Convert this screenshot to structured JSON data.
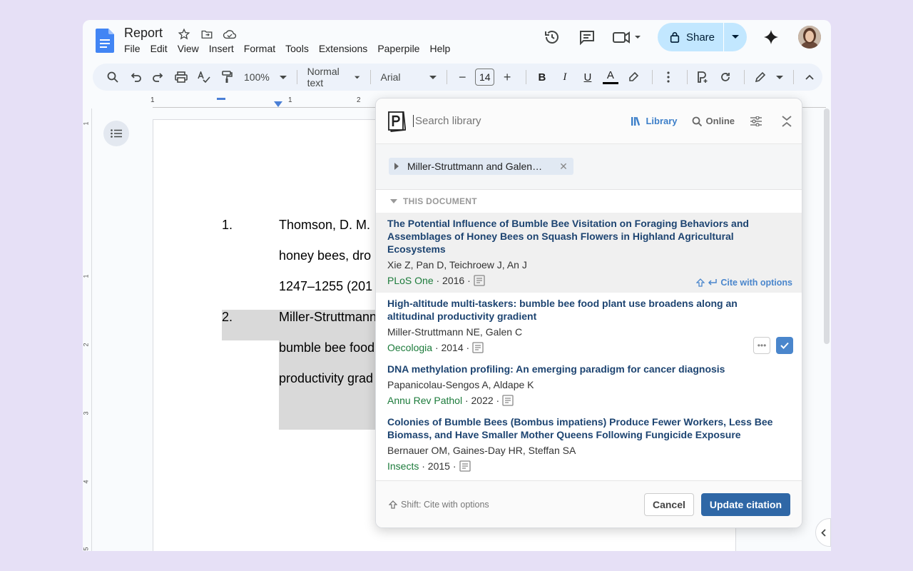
{
  "doc": {
    "title": "Report",
    "menu": [
      "File",
      "Edit",
      "View",
      "Insert",
      "Format",
      "Tools",
      "Extensions",
      "Paperpile",
      "Help"
    ]
  },
  "header": {
    "share_label": "Share"
  },
  "toolbar": {
    "zoom": "100%",
    "style": "Normal text",
    "font": "Arial",
    "font_size": "14",
    "minus": "−",
    "plus": "+",
    "bold": "B",
    "italic": "I",
    "underline": "U",
    "text_color": "A"
  },
  "ruler": {
    "marks": [
      "1",
      "1",
      "2"
    ]
  },
  "vruler": {
    "marks": [
      "1",
      "1",
      "2",
      "3",
      "4",
      "5"
    ]
  },
  "document": {
    "refs": [
      {
        "num": "1.",
        "lines": [
          "Thomson, D. M.",
          "honey bees, dro",
          "1247–1255 (201"
        ]
      },
      {
        "num": "2.",
        "lines": [
          "Miller-Struttmann",
          "bumble bee food",
          "productivity grad"
        ]
      }
    ]
  },
  "paperpile": {
    "search_placeholder": "Search library",
    "tab_library": "Library",
    "tab_online": "Online",
    "filter_chip": "Miller-Struttmann and Galen…",
    "section": "THIS DOCUMENT",
    "items": [
      {
        "title": "The Potential Influence of Bumble Bee Visitation on Foraging Behaviors and Assemblages of Honey Bees on Squash Flowers in Highland Agricultural Ecosystems",
        "authors": "Xie Z, Pan D, Teichroew J, An J",
        "journal": "PLoS One",
        "year": "· 2016 ·",
        "cite_options": "Cite with options"
      },
      {
        "title": "High-altitude multi-taskers: bumble bee food plant use broadens along an altitudinal productivity gradient",
        "authors": "Miller-Struttmann NE, Galen C",
        "journal": "Oecologia",
        "year": "· 2014 ·",
        "more": "•••"
      },
      {
        "title": "DNA methylation profiling: An emerging paradigm for cancer diagnosis",
        "authors": "Papanicolau-Sengos A, Aldape K",
        "journal": "Annu Rev Pathol",
        "year": "· 2022 ·"
      },
      {
        "title": "Colonies of Bumble Bees (Bombus impatiens) Produce Fewer Workers, Less Bee Biomass, and Have Smaller Mother Queens Following Fungicide Exposure",
        "authors": "Bernauer OM, Gaines-Day HR, Steffan SA",
        "journal": "Insects",
        "year": "· 2015 ·"
      }
    ],
    "footer_hint": "Shift: Cite with options",
    "cancel_label": "Cancel",
    "update_label": "Update citation"
  },
  "colors": {
    "accent": "#2f67a6",
    "title_blue": "#1d4471",
    "journal_green": "#1c7b3b",
    "share_bg": "#c2e7ff"
  }
}
